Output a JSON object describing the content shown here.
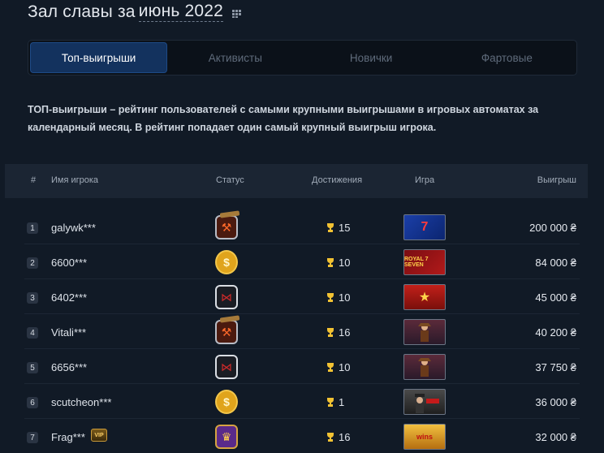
{
  "header": {
    "title_prefix": "Зал славы за",
    "month": "июнь 2022"
  },
  "tabs": [
    {
      "label": "Топ-выигрыши",
      "active": true
    },
    {
      "label": "Активисты",
      "active": false
    },
    {
      "label": "Новички",
      "active": false
    },
    {
      "label": "Фартовые",
      "active": false
    }
  ],
  "description": "ТОП-выигрыши – рейтинг пользователей с самыми крупными выигрышами в игровых автоматах за календарный месяц. В рейтинг попадает один самый крупный выигрыш игрока.",
  "table": {
    "columns": {
      "rank": "#",
      "name": "Имя игрока",
      "status": "Статус",
      "achievements": "Достижения",
      "game": "Игра",
      "winnings": "Выигрыш"
    },
    "rows": [
      {
        "rank": "1",
        "name": "galywk***",
        "status_icon": "axe-status-icon",
        "achievements": "15",
        "game_icon": "wild-game-icon",
        "game_text": "7",
        "win": "200 000 ₴"
      },
      {
        "rank": "2",
        "name": "6600***",
        "status_icon": "coin-status-icon",
        "achievements": "10",
        "game_icon": "royal-seven-game-icon",
        "game_text": "ROYAL 7 SEVEN",
        "win": "84 000 ₴"
      },
      {
        "rank": "3",
        "name": "6402***",
        "status_icon": "bowtie-status-icon",
        "achievements": "10",
        "game_icon": "star-game-icon",
        "game_text": "★",
        "win": "45 000 ₴"
      },
      {
        "rank": "4",
        "name": "Vitali***",
        "status_icon": "axe-status-icon",
        "achievements": "16",
        "game_icon": "book-game-icon",
        "game_text": "",
        "win": "40 200 ₴"
      },
      {
        "rank": "5",
        "name": "6656***",
        "status_icon": "bowtie-status-icon",
        "achievements": "10",
        "game_icon": "book-game-icon",
        "game_text": "",
        "win": "37 750 ₴"
      },
      {
        "rank": "6",
        "name": "scutcheon***",
        "status_icon": "coin-status-icon",
        "achievements": "1",
        "game_icon": "casino-game-icon",
        "game_text": "",
        "win": "36 000 ₴"
      },
      {
        "rank": "7",
        "name": "Frag***",
        "status_icon": "crown-status-icon",
        "achievements": "16",
        "game_icon": "wins-game-icon",
        "game_text": "wins",
        "win": "32 000 ₴",
        "vip": "VIP"
      }
    ]
  },
  "colors": {
    "background": "#111a26",
    "active_tab": "#13325e",
    "trophy": "#f2c233"
  }
}
